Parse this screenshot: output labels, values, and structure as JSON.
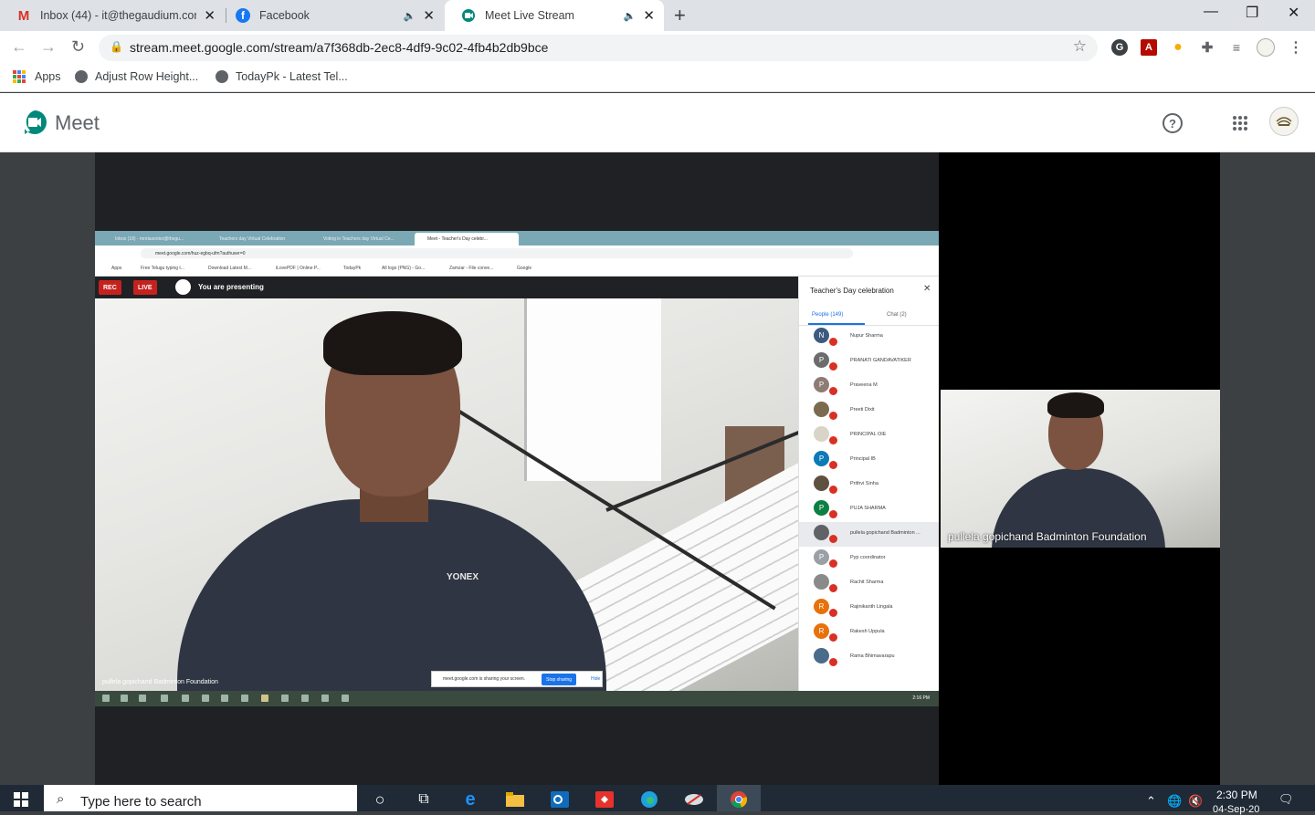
{
  "browser": {
    "tabs": [
      {
        "title": "Inbox (44) - it@thegaudium.com",
        "icon": "gmail-icon",
        "active": false
      },
      {
        "title": "Facebook",
        "icon": "facebook-icon",
        "active": false
      },
      {
        "title": "Meet Live Stream",
        "icon": "meet-icon",
        "active": true
      }
    ],
    "url": "stream.meet.google.com/stream/a7f368db-2ec8-4df9-9c02-4fb4b2db9bce",
    "bookmarks": [
      {
        "label": "Apps",
        "icon": "apps-grid-icon"
      },
      {
        "label": "Adjust Row Height...",
        "icon": "globe-icon"
      },
      {
        "label": "TodayPk - Latest Tel...",
        "icon": "globe-icon"
      }
    ]
  },
  "meet": {
    "app_name": "Meet",
    "help_icon": "?"
  },
  "shared_screen": {
    "tabs": [
      "Inbox (18) - mrelasontor@thegu...",
      "Teachers day Virtual Celebration",
      "Voting in Teachers day Virtual Ce...",
      "Meet - Teacher's Day celebr..."
    ],
    "url": "meet.google.com/huz-egbq-ufm?authuser=0",
    "bookmarks": [
      "Apps",
      "Free Telugu typing t...",
      "Download Latest M...",
      "iLovePDF | Online P...",
      "TodayPk",
      "All logo (PNG) - Go...",
      "Zamzar - File conve...",
      "Google"
    ],
    "rec_label": "REC",
    "live_label": "LIVE",
    "presenting_text": "You are presenting",
    "video_name": "pullela gopichand Badminton Foundation",
    "shirt_logo": "YONEX",
    "share_notice": "meet.google.com is sharing your screen.",
    "stop_label": "Stop sharing",
    "hide_label": "Hide",
    "panel": {
      "title": "Teacher's Day celebration",
      "people_tab": "People (149)",
      "chat_tab": "Chat (2)",
      "participants": [
        {
          "initial": "N",
          "name": "Nupur Sharma",
          "color": "#3d5a80"
        },
        {
          "initial": "P",
          "name": "PRANATI GANDAVATIKER",
          "color": "#6c6c6c"
        },
        {
          "initial": "P",
          "name": "Praveena M",
          "color": "#8d7b74"
        },
        {
          "initial": "",
          "name": "Preeti Dixit",
          "color": "#7a6a4f"
        },
        {
          "initial": "",
          "name": "PRINCIPAL OIE",
          "color": "#d9d4c7"
        },
        {
          "initial": "P",
          "name": "Principal IB",
          "color": "#0b7ab8"
        },
        {
          "initial": "",
          "name": "Prithvi Sinha",
          "color": "#5e5140"
        },
        {
          "initial": "P",
          "name": "PUJA SHARMA",
          "color": "#0b8043"
        },
        {
          "initial": "",
          "name": "pullela gopichand Badminton ...",
          "color": "#5f6368"
        },
        {
          "initial": "P",
          "name": "Pyp coordinator",
          "color": "#9aa0a6"
        },
        {
          "initial": "",
          "name": "Rachit Sharma",
          "color": "#8a8a8a"
        },
        {
          "initial": "R",
          "name": "Rajinikanth Lingala",
          "color": "#e8710a"
        },
        {
          "initial": "R",
          "name": "Rakesh Uppula",
          "color": "#e8710a"
        },
        {
          "initial": "",
          "name": "Rama Bhimavarapu",
          "color": "#4a6b8a"
        }
      ]
    },
    "taskbar_clock": "2:16 PM"
  },
  "side_video": {
    "name": "pullela gopichand Badminton Foundation"
  },
  "windows": {
    "search_placeholder": "Type here to search",
    "time": "2:30 PM",
    "date": "04-Sep-20"
  }
}
